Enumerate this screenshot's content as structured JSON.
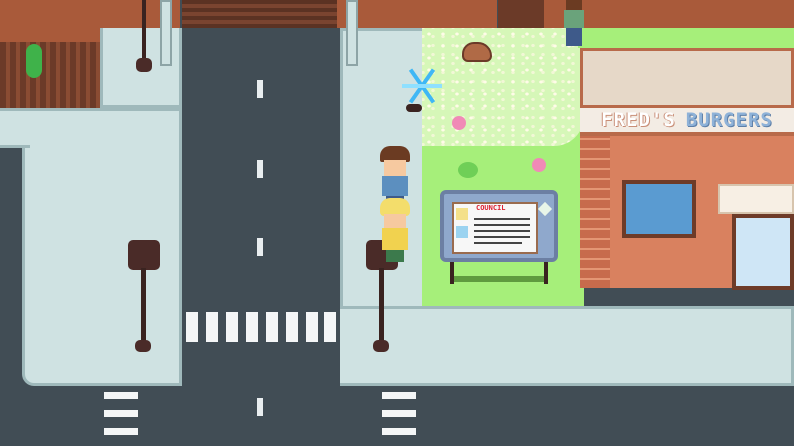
{
  "scene": {
    "type": "pixel-art-overworld",
    "storefront_sign": {
      "word1": "FRED'S",
      "word2": "BURGERS"
    },
    "colors": {
      "road": "#414d55",
      "sidewalk": "#cfe2e2",
      "grass": "#a6ef7a",
      "brick_wall": "#a95a3a",
      "building": "#d9815f",
      "window": "#5a9bd1"
    }
  },
  "board": {
    "title": "COUNCIL"
  },
  "sprites": [
    "player-boy-icon",
    "companion-blond-icon",
    "npc-girl-icon",
    "sparkle-icon",
    "rock-icon",
    "flower-icon",
    "street-lamp-icon"
  ]
}
